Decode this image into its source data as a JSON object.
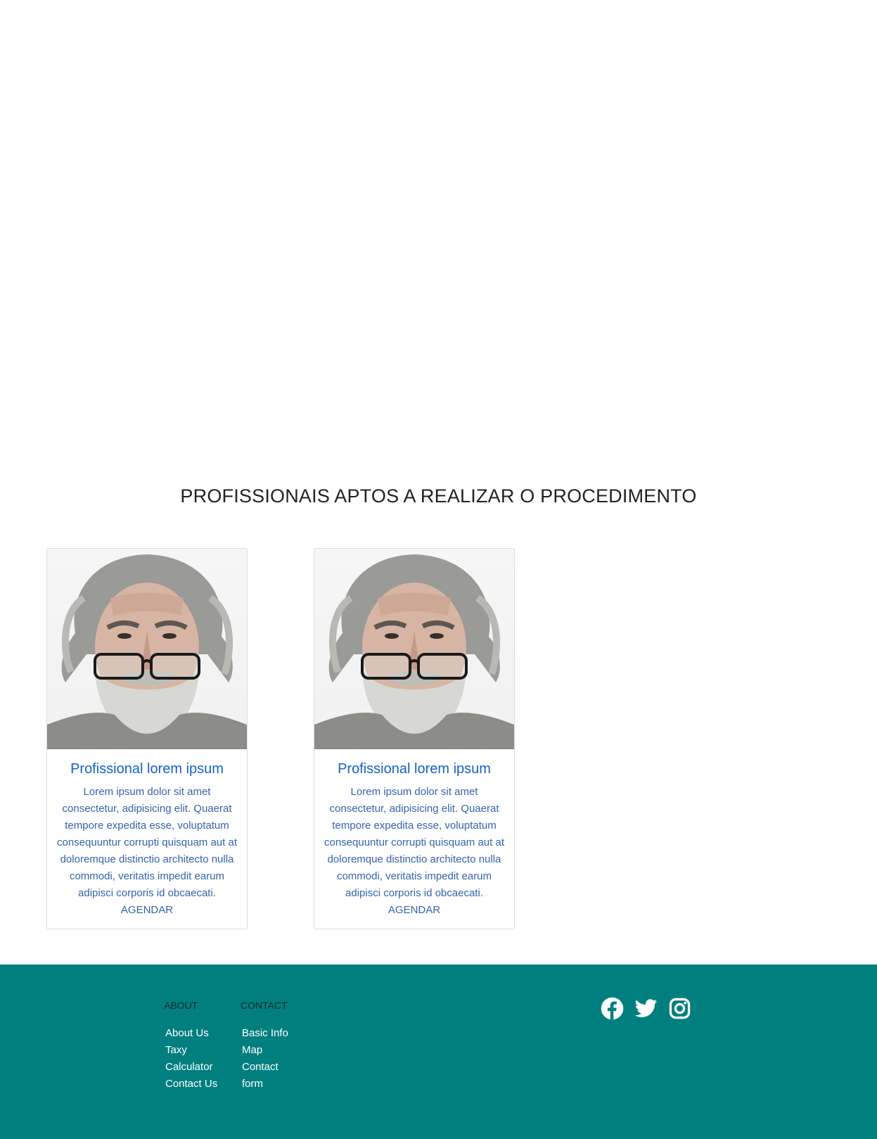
{
  "section": {
    "title": "PROFISSIONAIS APTOS A REALIZAR O PROCEDIMENTO"
  },
  "professionals": [
    {
      "name": "Profissional lorem ipsum",
      "description": "Lorem ipsum dolor sit amet consectetur, adipisicing elit. Quaerat tempore expedita esse, voluptatum consequuntur corrupti quisquam aut at doloremque distinctio architecto nulla commodi, veritatis impedit earum adipisci corporis id obcaecati.",
      "action": "AGENDAR"
    },
    {
      "name": "Profissional lorem ipsum",
      "description": "Lorem ipsum dolor sit amet consectetur, adipisicing elit. Quaerat tempore expedita esse, voluptatum consequuntur corrupti quisquam aut at doloremque distinctio architecto nulla commodi, veritatis impedit earum adipisci corporis id obcaecati.",
      "action": "AGENDAR"
    }
  ],
  "footer": {
    "about": {
      "heading": "ABOUT",
      "links": [
        "About Us",
        "Taxy Calculator",
        "Contact Us"
      ]
    },
    "contact": {
      "heading": "CONTACT",
      "links": [
        "Basic Info",
        "Map",
        "Contact form"
      ]
    },
    "social_icons": [
      "facebook-icon",
      "twitter-icon",
      "instagram-icon"
    ]
  },
  "colors": {
    "footer_background": "#017f7f",
    "card_title": "#1462c8",
    "card_text": "#3563a8"
  }
}
